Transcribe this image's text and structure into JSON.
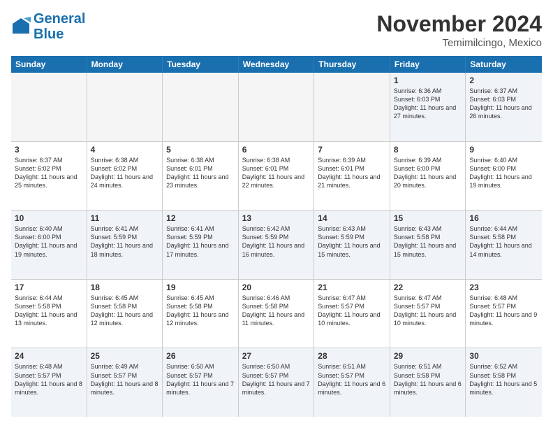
{
  "header": {
    "logo_line1": "General",
    "logo_line2": "Blue",
    "month_title": "November 2024",
    "location": "Temimilcingo, Mexico"
  },
  "days": [
    "Sunday",
    "Monday",
    "Tuesday",
    "Wednesday",
    "Thursday",
    "Friday",
    "Saturday"
  ],
  "rows": [
    [
      {
        "day": "",
        "text": ""
      },
      {
        "day": "",
        "text": ""
      },
      {
        "day": "",
        "text": ""
      },
      {
        "day": "",
        "text": ""
      },
      {
        "day": "",
        "text": ""
      },
      {
        "day": "1",
        "text": "Sunrise: 6:36 AM\nSunset: 6:03 PM\nDaylight: 11 hours and 27 minutes."
      },
      {
        "day": "2",
        "text": "Sunrise: 6:37 AM\nSunset: 6:03 PM\nDaylight: 11 hours and 26 minutes."
      }
    ],
    [
      {
        "day": "3",
        "text": "Sunrise: 6:37 AM\nSunset: 6:02 PM\nDaylight: 11 hours and 25 minutes."
      },
      {
        "day": "4",
        "text": "Sunrise: 6:38 AM\nSunset: 6:02 PM\nDaylight: 11 hours and 24 minutes."
      },
      {
        "day": "5",
        "text": "Sunrise: 6:38 AM\nSunset: 6:01 PM\nDaylight: 11 hours and 23 minutes."
      },
      {
        "day": "6",
        "text": "Sunrise: 6:38 AM\nSunset: 6:01 PM\nDaylight: 11 hours and 22 minutes."
      },
      {
        "day": "7",
        "text": "Sunrise: 6:39 AM\nSunset: 6:01 PM\nDaylight: 11 hours and 21 minutes."
      },
      {
        "day": "8",
        "text": "Sunrise: 6:39 AM\nSunset: 6:00 PM\nDaylight: 11 hours and 20 minutes."
      },
      {
        "day": "9",
        "text": "Sunrise: 6:40 AM\nSunset: 6:00 PM\nDaylight: 11 hours and 19 minutes."
      }
    ],
    [
      {
        "day": "10",
        "text": "Sunrise: 6:40 AM\nSunset: 6:00 PM\nDaylight: 11 hours and 19 minutes."
      },
      {
        "day": "11",
        "text": "Sunrise: 6:41 AM\nSunset: 5:59 PM\nDaylight: 11 hours and 18 minutes."
      },
      {
        "day": "12",
        "text": "Sunrise: 6:41 AM\nSunset: 5:59 PM\nDaylight: 11 hours and 17 minutes."
      },
      {
        "day": "13",
        "text": "Sunrise: 6:42 AM\nSunset: 5:59 PM\nDaylight: 11 hours and 16 minutes."
      },
      {
        "day": "14",
        "text": "Sunrise: 6:43 AM\nSunset: 5:59 PM\nDaylight: 11 hours and 15 minutes."
      },
      {
        "day": "15",
        "text": "Sunrise: 6:43 AM\nSunset: 5:58 PM\nDaylight: 11 hours and 15 minutes."
      },
      {
        "day": "16",
        "text": "Sunrise: 6:44 AM\nSunset: 5:58 PM\nDaylight: 11 hours and 14 minutes."
      }
    ],
    [
      {
        "day": "17",
        "text": "Sunrise: 6:44 AM\nSunset: 5:58 PM\nDaylight: 11 hours and 13 minutes."
      },
      {
        "day": "18",
        "text": "Sunrise: 6:45 AM\nSunset: 5:58 PM\nDaylight: 11 hours and 12 minutes."
      },
      {
        "day": "19",
        "text": "Sunrise: 6:45 AM\nSunset: 5:58 PM\nDaylight: 11 hours and 12 minutes."
      },
      {
        "day": "20",
        "text": "Sunrise: 6:46 AM\nSunset: 5:58 PM\nDaylight: 11 hours and 11 minutes."
      },
      {
        "day": "21",
        "text": "Sunrise: 6:47 AM\nSunset: 5:57 PM\nDaylight: 11 hours and 10 minutes."
      },
      {
        "day": "22",
        "text": "Sunrise: 6:47 AM\nSunset: 5:57 PM\nDaylight: 11 hours and 10 minutes."
      },
      {
        "day": "23",
        "text": "Sunrise: 6:48 AM\nSunset: 5:57 PM\nDaylight: 11 hours and 9 minutes."
      }
    ],
    [
      {
        "day": "24",
        "text": "Sunrise: 6:48 AM\nSunset: 5:57 PM\nDaylight: 11 hours and 8 minutes."
      },
      {
        "day": "25",
        "text": "Sunrise: 6:49 AM\nSunset: 5:57 PM\nDaylight: 11 hours and 8 minutes."
      },
      {
        "day": "26",
        "text": "Sunrise: 6:50 AM\nSunset: 5:57 PM\nDaylight: 11 hours and 7 minutes."
      },
      {
        "day": "27",
        "text": "Sunrise: 6:50 AM\nSunset: 5:57 PM\nDaylight: 11 hours and 7 minutes."
      },
      {
        "day": "28",
        "text": "Sunrise: 6:51 AM\nSunset: 5:57 PM\nDaylight: 11 hours and 6 minutes."
      },
      {
        "day": "29",
        "text": "Sunrise: 6:51 AM\nSunset: 5:58 PM\nDaylight: 11 hours and 6 minutes."
      },
      {
        "day": "30",
        "text": "Sunrise: 6:52 AM\nSunset: 5:58 PM\nDaylight: 11 hours and 5 minutes."
      }
    ]
  ]
}
